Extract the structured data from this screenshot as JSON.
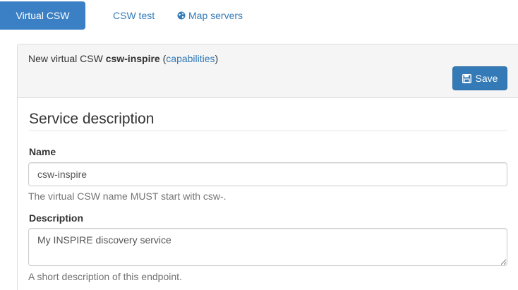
{
  "tabs": {
    "virtual_csw": "Virtual CSW",
    "csw_test": "CSW test",
    "map_servers": "Map servers"
  },
  "panel": {
    "heading_prefix": "New virtual CSW ",
    "csw_name": "csw-inspire",
    "open_paren": " (",
    "capabilities_link": "capabilities",
    "close_paren": ")",
    "save_label": "Save"
  },
  "form": {
    "section_title": "Service description",
    "name_label": "Name",
    "name_value": "csw-inspire",
    "name_help": "The virtual CSW name MUST start with csw-.",
    "description_label": "Description",
    "description_value": "My INSPIRE discovery service",
    "description_help": "A short description of this endpoint."
  },
  "colors": {
    "primary": "#337ab7",
    "active_tab": "#3b7fc4",
    "panel_heading_bg": "#f5f5f5"
  },
  "icons": {
    "map_servers_tab": "globe-icon",
    "save_button": "floppy-disk-icon"
  }
}
